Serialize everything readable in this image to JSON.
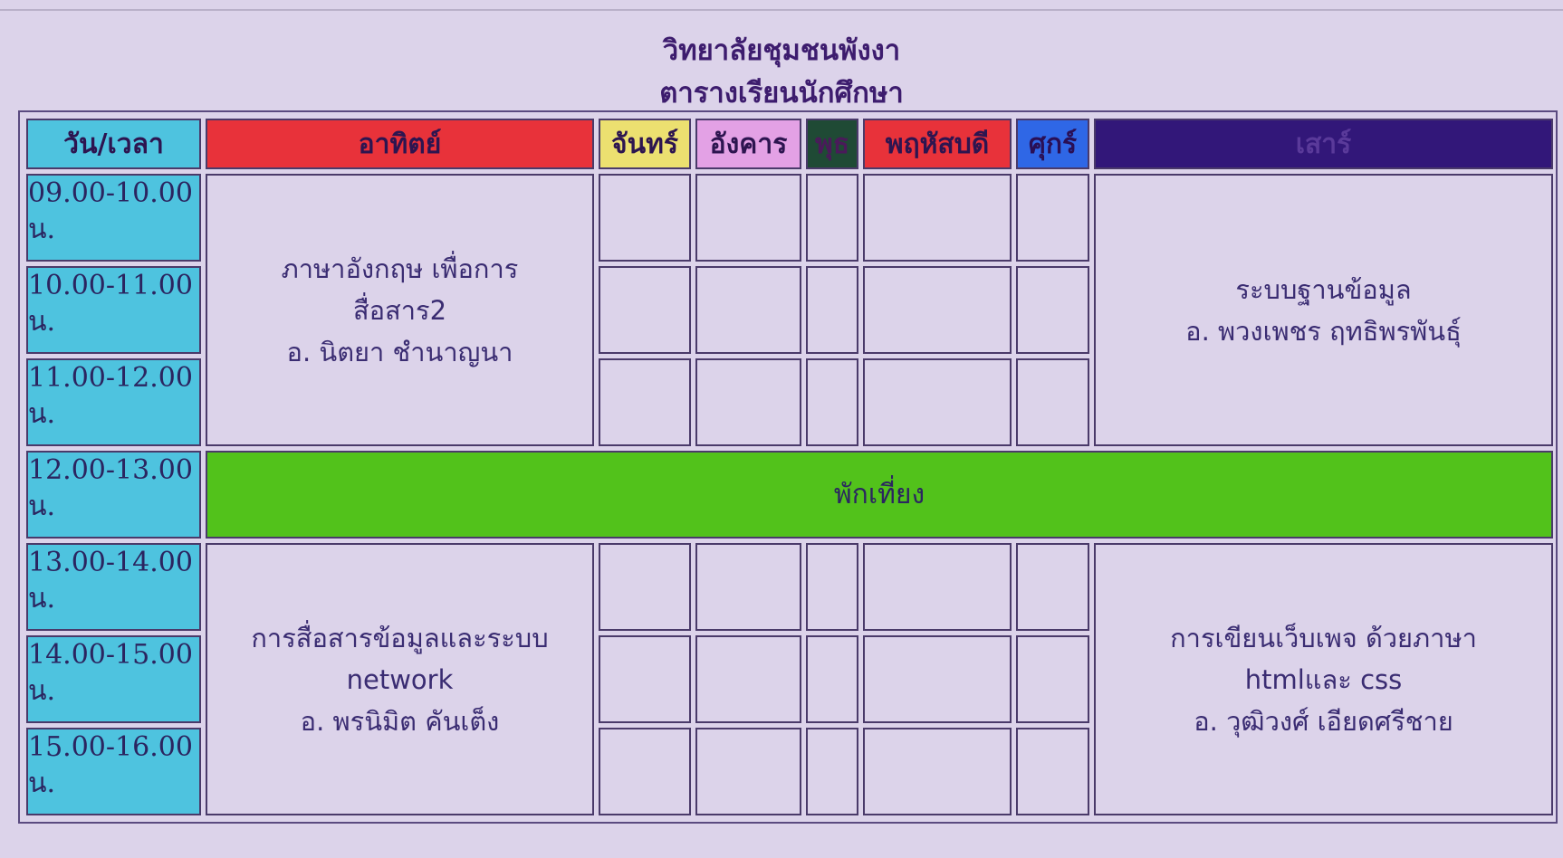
{
  "page": {
    "college_name": "วิทยาลัยชุมชนพังงา",
    "subtitle": "ตารางเรียนนักศึกษา"
  },
  "headers": {
    "time": "วัน/เวลา",
    "sun": "อาทิตย์",
    "mon": "จันทร์",
    "tue": "อังคาร",
    "wed": "พุธ",
    "thu": "พฤหัสบดี",
    "fri": "ศุกร์",
    "sat": "เสาร์"
  },
  "times": [
    "09.00-10.00 น.",
    "10.00-11.00 น.",
    "11.00-12.00 น.",
    "12.00-13.00 น.",
    "13.00-14.00 น.",
    "14.00-15.00 น.",
    "15.00-16.00 น."
  ],
  "courses": {
    "sun_morning": {
      "line1": "ภาษาอังกฤษ เพื่อการ",
      "line2": "สื่อสาร2",
      "teacher": "อ. นิตยา ชำนาญนา"
    },
    "sat_morning": {
      "line1": "ระบบฐานข้อมูล",
      "teacher": "อ. พวงเพชร ฤทธิพรพันธุ์"
    },
    "sun_afternoon": {
      "line1": "การสื่อสารข้อมูลและระบบ",
      "line2": "network",
      "teacher": "อ. พรนิมิต คันเต็ง"
    },
    "sat_afternoon": {
      "line1": "การเขียนเว็บเพจ ด้วยภาษา",
      "line2": "htmlและ css",
      "teacher": "อ. วุฒิวงศ์ เอียดศรีชาย"
    }
  },
  "lunch": "พักเที่ยง",
  "colors": {
    "time_column": "#4ec3df",
    "sunday": "#e8323a",
    "monday": "#ece070",
    "tuesday": "#e3a1e5",
    "wednesday": "#1f4a35",
    "thursday": "#e8323a",
    "friday": "#2f67e6",
    "saturday": "#321779",
    "lunch": "#52c21b",
    "background": "#dcd3ea"
  }
}
